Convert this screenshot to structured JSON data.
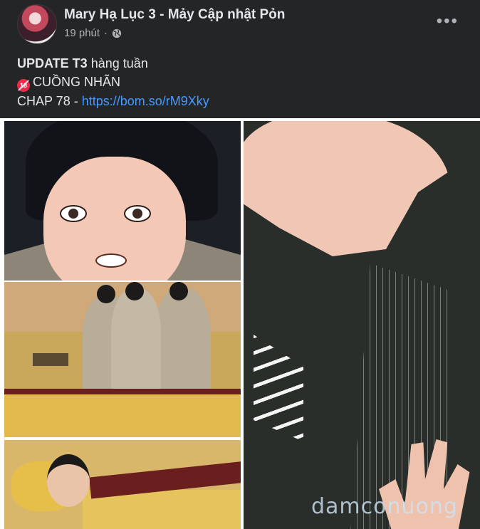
{
  "header": {
    "author": "Mary Hạ Lục 3 - Mảy Cập nhật Pỏn",
    "time": "19 phút",
    "privacy_icon": "globe-icon",
    "more_icon": "more-options-icon"
  },
  "caption": {
    "line1_bold": "UPDATE T3",
    "line1_rest": " hàng tuần",
    "line2_badge_icon": "no-under-18-icon",
    "line2_badge_text": "18",
    "line2_text": "CUỒNG NHÃN",
    "line3_prefix": "CHAP 78 - ",
    "line3_link": "https://bom.so/rM9Xky"
  },
  "photos": {
    "watermark": "damconuong"
  },
  "colors": {
    "background": "#242526",
    "text_primary": "#e4e6eb",
    "text_secondary": "#b0b3b8",
    "link": "#4599ff"
  }
}
